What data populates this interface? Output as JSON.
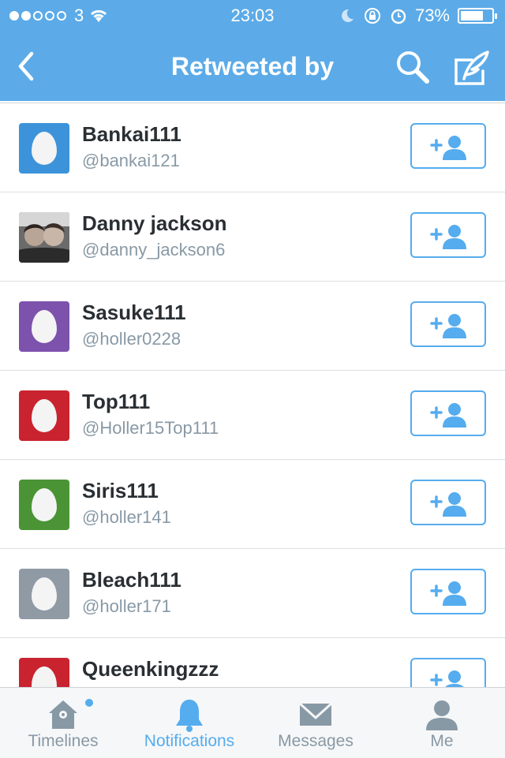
{
  "status_bar": {
    "carrier": "3",
    "time": "23:03",
    "battery": "73%",
    "battery_level": 0.73
  },
  "nav": {
    "title": "Retweeted by"
  },
  "users": [
    {
      "name": "Bankai111",
      "handle": "@bankai121",
      "avatar_color": "#3d93da",
      "avatar_type": "egg"
    },
    {
      "name": "Danny jackson",
      "handle": "@danny_jackson6",
      "avatar_color": "#5a5a5a",
      "avatar_type": "photo"
    },
    {
      "name": "Sasuke111",
      "handle": "@holler0228",
      "avatar_color": "#7d52ad",
      "avatar_type": "egg"
    },
    {
      "name": "Top111",
      "handle": "@Holler15Top111",
      "avatar_color": "#c9232f",
      "avatar_type": "egg"
    },
    {
      "name": "Siris111",
      "handle": "@holler141",
      "avatar_color": "#4a9436",
      "avatar_type": "egg"
    },
    {
      "name": "Bleach111",
      "handle": "@holler171",
      "avatar_color": "#8f9aa5",
      "avatar_type": "egg"
    },
    {
      "name": "Queenkingzzz",
      "handle": "",
      "avatar_color": "#c9232f",
      "avatar_type": "egg"
    }
  ],
  "tabs": [
    {
      "label": "Timelines",
      "icon": "home-icon"
    },
    {
      "label": "Notifications",
      "icon": "bell-icon",
      "active": true
    },
    {
      "label": "Messages",
      "icon": "envelope-icon"
    },
    {
      "label": "Me",
      "icon": "person-icon"
    }
  ],
  "colors": {
    "header": "#5cabe8",
    "accent": "#55acee",
    "name_text": "#292f33",
    "secondary_text": "#8899a6"
  }
}
